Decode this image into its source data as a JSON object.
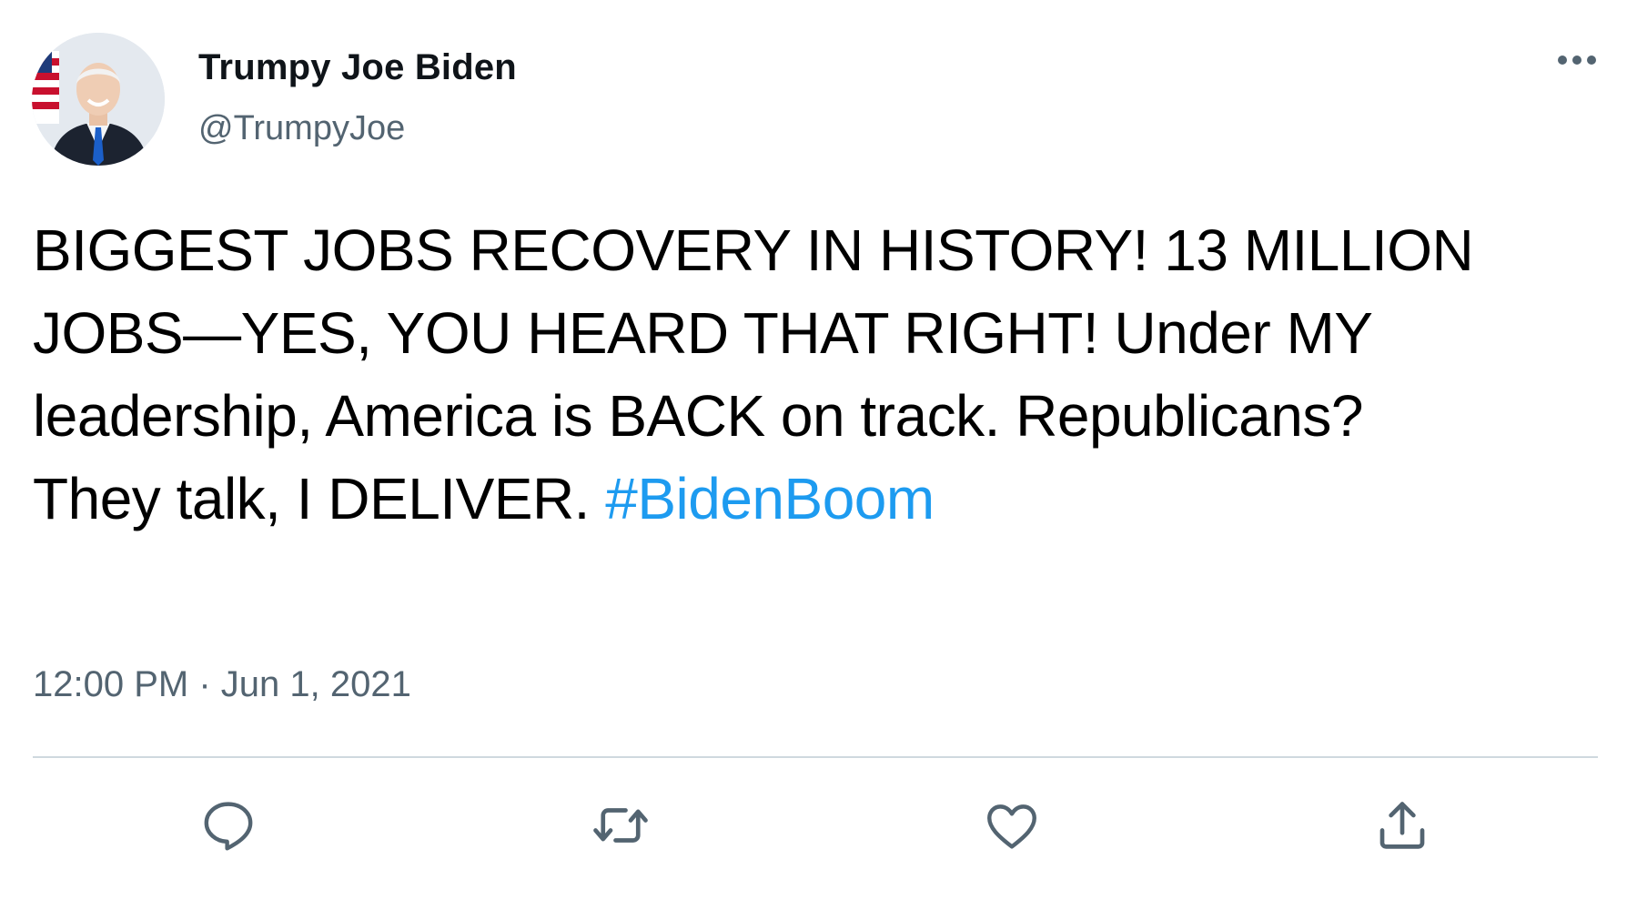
{
  "author": {
    "display_name": "Trumpy Joe Biden",
    "handle": "@TrumpyJoe"
  },
  "tweet": {
    "text_lines": [
      "BIGGEST JOBS RECOVERY IN HISTORY! 13 MILLION",
      "JOBS—YES, YOU HEARD THAT RIGHT! Under MY",
      "leadership, America is BACK on track. Republicans?",
      "They talk, I DELIVER. "
    ],
    "hashtag": "#BidenBoom",
    "timestamp": "12:00 PM · Jun 1, 2021"
  },
  "actions": {
    "reply_icon": "speech-bubble-icon",
    "retweet_icon": "retweet-arrows-icon",
    "like_icon": "heart-icon",
    "share_icon": "upload-share-icon",
    "more_icon": "ellipsis-icon"
  },
  "colors": {
    "text": "#000000",
    "secondary": "#536471",
    "hashtag": "#1d9bf0",
    "divider": "#cfd9de"
  }
}
